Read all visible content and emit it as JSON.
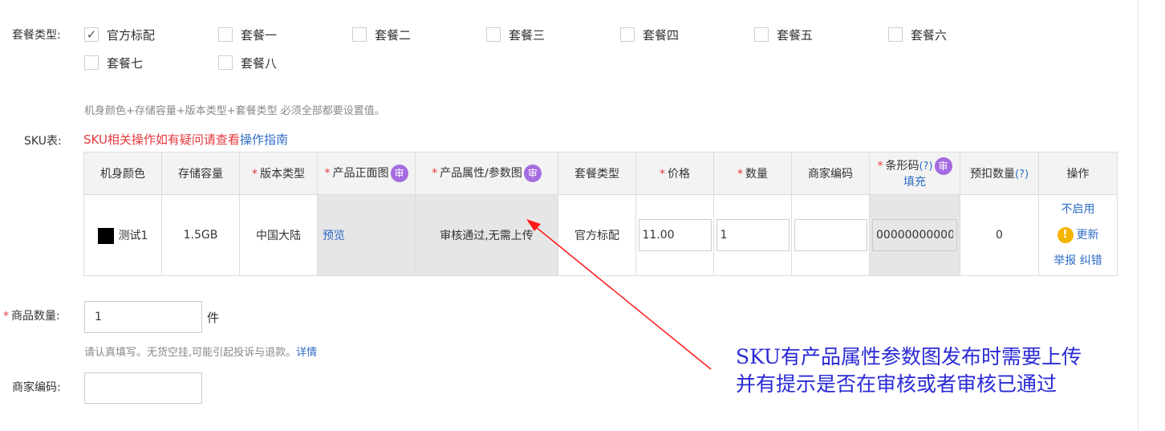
{
  "package": {
    "label": "套餐类型:",
    "options": [
      {
        "label": "官方标配",
        "checked": true
      },
      {
        "label": "套餐一",
        "checked": false
      },
      {
        "label": "套餐二",
        "checked": false
      },
      {
        "label": "套餐三",
        "checked": false
      },
      {
        "label": "套餐四",
        "checked": false
      },
      {
        "label": "套餐五",
        "checked": false
      },
      {
        "label": "套餐六",
        "checked": false
      },
      {
        "label": "套餐七",
        "checked": false
      },
      {
        "label": "套餐八",
        "checked": false
      }
    ],
    "hint": "机身颜色+存储容量+版本类型+套餐类型 必须全部都要设置值。"
  },
  "sku": {
    "label": "SKU表:",
    "notice": "SKU相关操作如有疑问请查看",
    "guide_link": "操作指南",
    "headers": {
      "color": "机身颜色",
      "storage": "存储容量",
      "version": "版本类型",
      "front_image": "产品正面图",
      "param_image": "产品属性/参数图",
      "package_type": "套餐类型",
      "price": "价格",
      "quantity": "数量",
      "merchant_code": "商家编码",
      "barcode": "条形码",
      "barcode_help": "(?)",
      "barcode_fill": "填充",
      "reserve": "预扣数量",
      "reserve_help": "(?)",
      "actions": "操作",
      "review_badge": "审",
      "required_mark": "*"
    },
    "row": {
      "color": "测试1",
      "color_hex": "#000000",
      "storage": "1.5GB",
      "version": "中国大陆",
      "front_image_link": "预览",
      "param_image_status": "审核通过,无需上传",
      "package_type": "官方标配",
      "price": "11.00",
      "quantity": "1",
      "merchant_code": "",
      "barcode": "0000000000000",
      "reserve": "0",
      "action_disable": "不启用",
      "action_update": "更新",
      "action_report": "举报",
      "action_correct": "纠错",
      "warn_icon": "!"
    }
  },
  "product_quantity": {
    "label": "商品数量:",
    "value": "1",
    "unit": "件",
    "hint": "请认真填写。无货空挂,可能引起投诉与退款。",
    "hint_link": "详情"
  },
  "merchant_code": {
    "label": "商家编码:",
    "value": ""
  },
  "annotation": {
    "line1": "SKU有产品属性参数图发布时需要上传",
    "line2": "并有提示是否在审核或者审核已通过"
  }
}
